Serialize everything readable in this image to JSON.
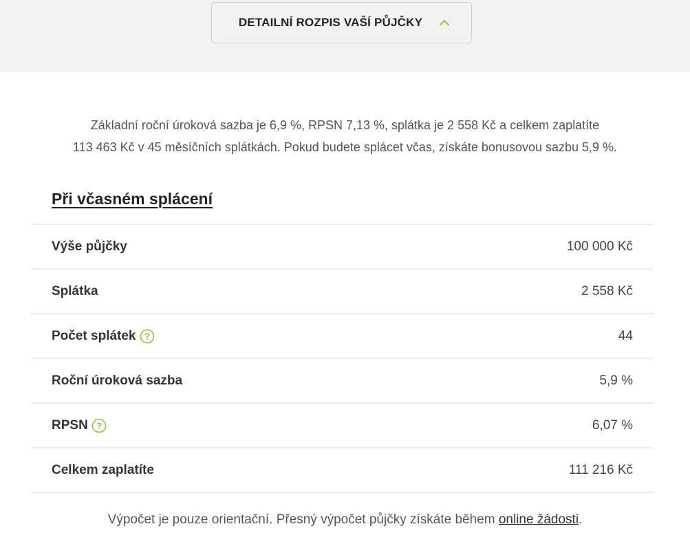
{
  "toggle": {
    "label": "DETAILNÍ ROZPIS VAŠÍ PŮJČKY",
    "icon": "chevron-up-icon"
  },
  "summary": {
    "line1": "Základní roční úroková sazba je 6,9 %, RPSN 7,13 %, splátka je 2 558 Kč a celkem zaplatíte",
    "line2": "113 463 Kč v 45 měsíčních splátkách. Pokud budete splácet včas, získáte bonusovou sazbu 5,9 %."
  },
  "section": {
    "title": "Při včasném splácení"
  },
  "rows": [
    {
      "label": "Výše půjčky",
      "value": "100 000 Kč"
    },
    {
      "label": "Splátka",
      "value": "2 558 Kč"
    },
    {
      "label": "Počet splátek",
      "value": "44"
    },
    {
      "label": "Roční úroková sazba",
      "value": "5,9 %"
    },
    {
      "label": "RPSN",
      "value": "6,07 %"
    },
    {
      "label": "Celkem zaplatíte",
      "value": "111 216 Kč"
    }
  ],
  "footnote": {
    "text": "Výpočet je pouze orientační. Přesný výpočet půjčky získáte během ",
    "link": "online žádosti",
    "end": "."
  },
  "colors": {
    "accent": "#8dc63f",
    "band": "#f2f2f2"
  }
}
